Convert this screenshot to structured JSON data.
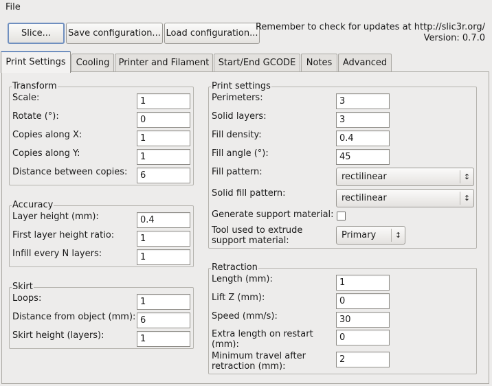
{
  "menubar": {
    "file": "File"
  },
  "toolbar": {
    "slice": "Slice...",
    "save": "Save configuration...",
    "load": "Load configuration...",
    "update_line1": "Remember to check for updates at http://slic3r.org/",
    "update_line2": "Version: 0.7.0"
  },
  "tabs": [
    "Print Settings",
    "Cooling",
    "Printer and Filament",
    "Start/End GCODE",
    "Notes",
    "Advanced"
  ],
  "active_tab": "Print Settings",
  "transform": {
    "title": "Transform",
    "scale": {
      "label": "Scale:",
      "value": "1"
    },
    "rotate": {
      "label": "Rotate (°):",
      "value": "0"
    },
    "copies_x": {
      "label": "Copies along X:",
      "value": "1"
    },
    "copies_y": {
      "label": "Copies along Y:",
      "value": "1"
    },
    "distance": {
      "label": "Distance between copies:",
      "value": "6"
    }
  },
  "accuracy": {
    "title": "Accuracy",
    "layer_height": {
      "label": "Layer height (mm):",
      "value": "0.4"
    },
    "first_layer_ratio": {
      "label": "First layer height ratio:",
      "value": "1"
    },
    "infill_every": {
      "label": "Infill every N layers:",
      "value": "1"
    }
  },
  "skirt": {
    "title": "Skirt",
    "loops": {
      "label": "Loops:",
      "value": "1"
    },
    "distance": {
      "label": "Distance from object (mm):",
      "value": "6"
    },
    "height": {
      "label": "Skirt height (layers):",
      "value": "1"
    }
  },
  "print_settings": {
    "title": "Print settings",
    "perimeters": {
      "label": "Perimeters:",
      "value": "3"
    },
    "solid_layers": {
      "label": "Solid layers:",
      "value": "3"
    },
    "fill_density": {
      "label": "Fill density:",
      "value": "0.4"
    },
    "fill_angle": {
      "label": "Fill angle (°):",
      "value": "45"
    },
    "fill_pattern": {
      "label": "Fill pattern:",
      "value": "rectilinear"
    },
    "solid_fill_pattern": {
      "label": "Solid fill pattern:",
      "value": "rectilinear"
    },
    "support_material": {
      "label": "Generate support material:",
      "checked": false
    },
    "support_extruder": {
      "label": "Tool used to extrude support material:",
      "value": "Primary"
    }
  },
  "retraction": {
    "title": "Retraction",
    "length": {
      "label": "Length (mm):",
      "value": "1"
    },
    "lift_z": {
      "label": "Lift Z (mm):",
      "value": "0"
    },
    "speed": {
      "label": "Speed (mm/s):",
      "value": "30"
    },
    "extra_length": {
      "label": "Extra length on restart (mm):",
      "value": "0"
    },
    "min_travel": {
      "label": "Minimum travel after retraction (mm):",
      "value": "2"
    }
  }
}
